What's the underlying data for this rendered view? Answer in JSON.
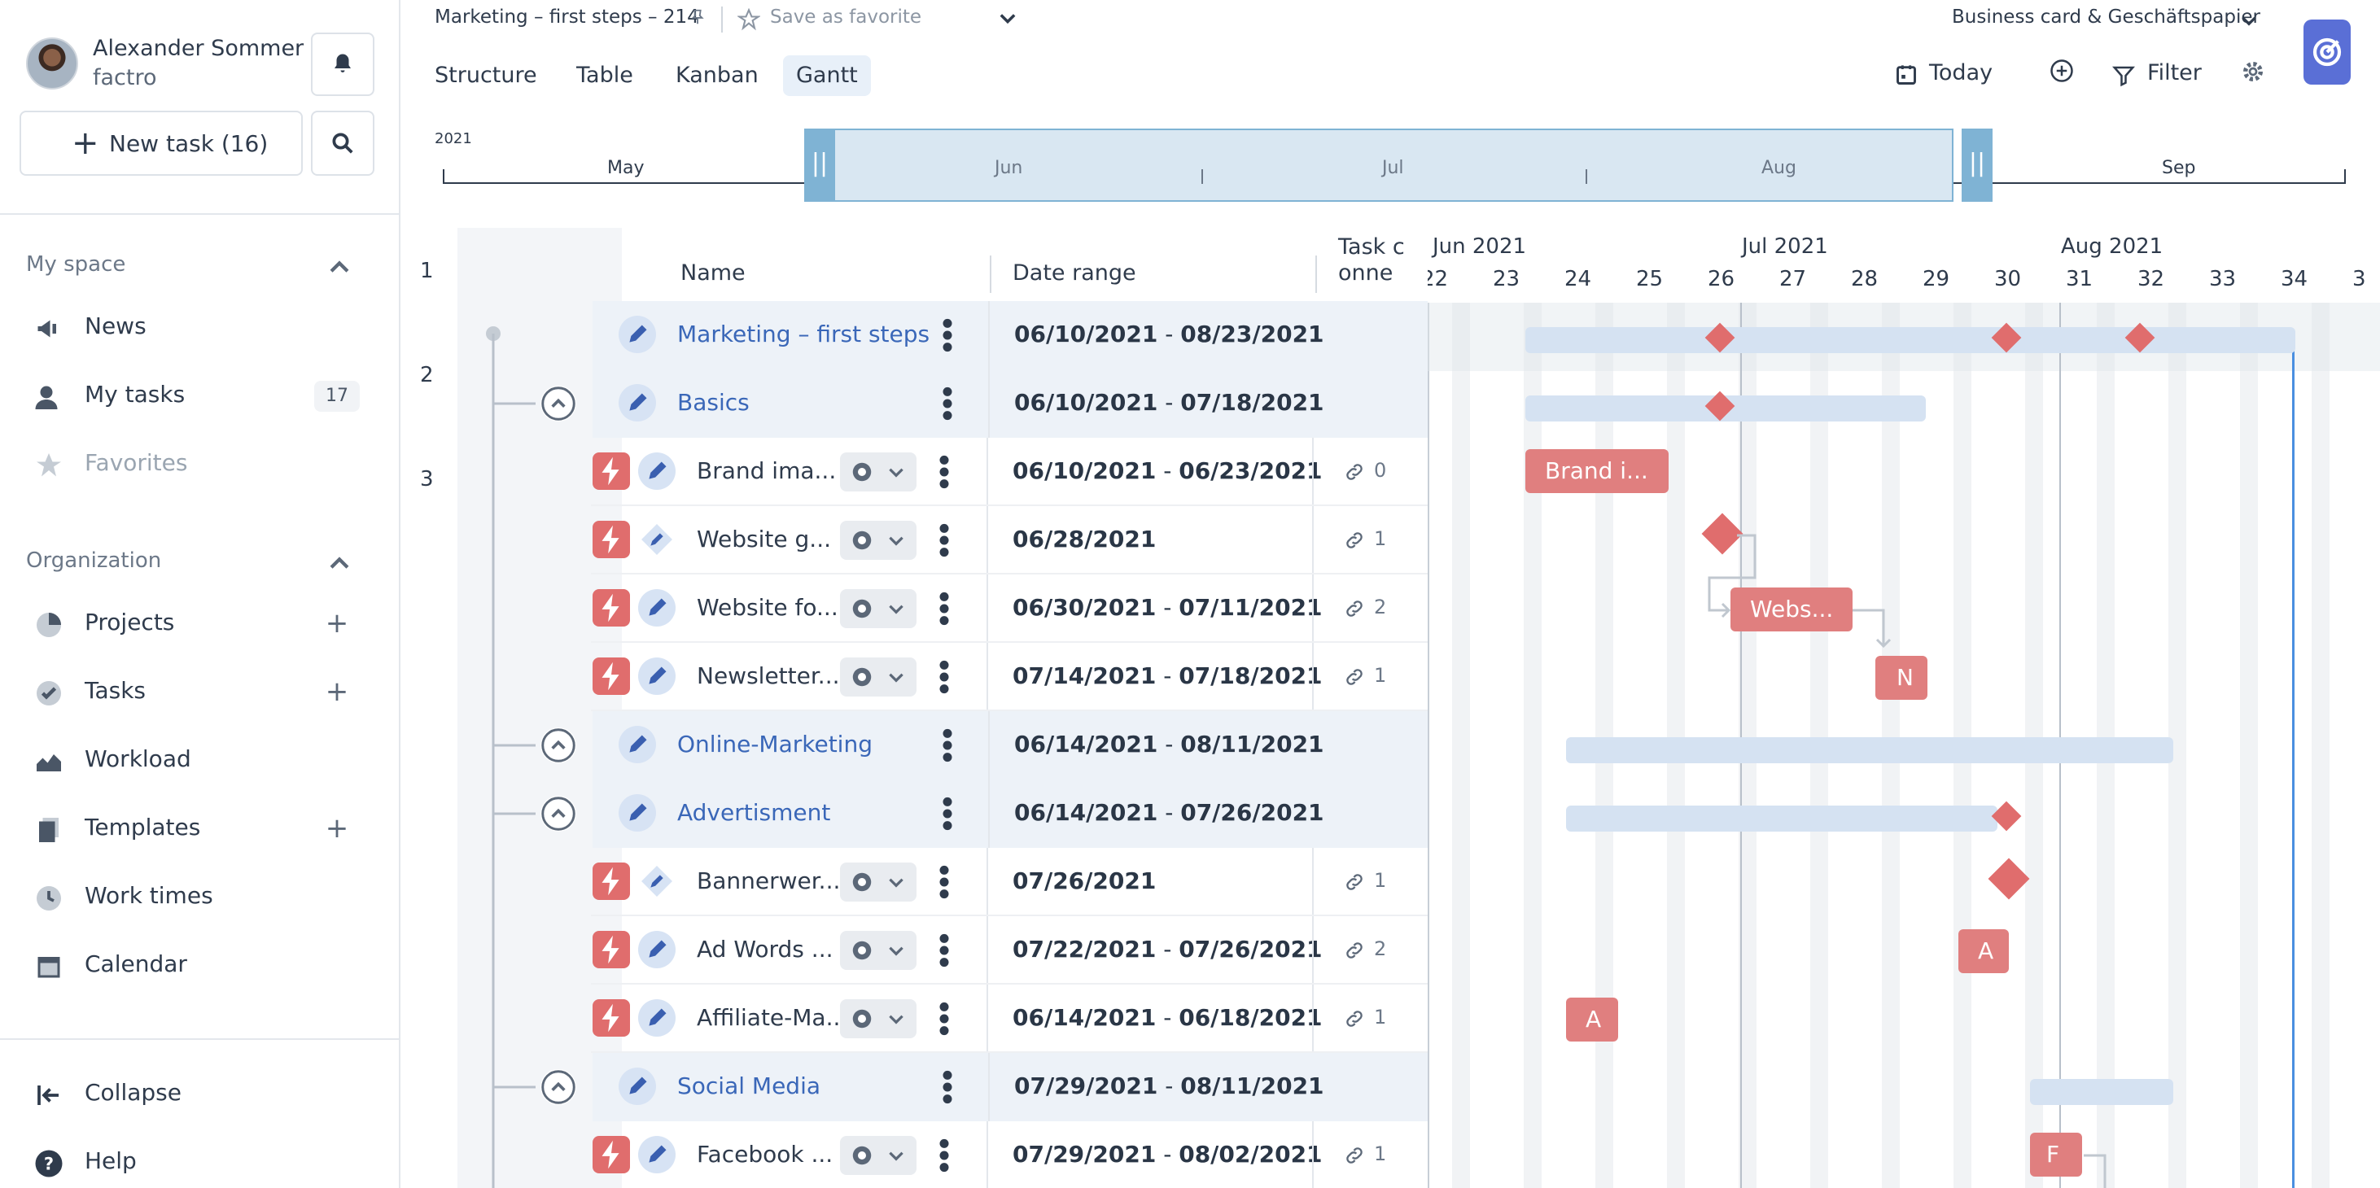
{
  "user": {
    "name": "Alexander Sommer",
    "company": "factro"
  },
  "sidebar": {
    "new_task": "New task (16)",
    "my_space_title": "My space",
    "my_space": [
      {
        "label": "News",
        "icon": "megaphone-icon"
      },
      {
        "label": "My tasks",
        "icon": "user-icon",
        "badge": "17"
      },
      {
        "label": "Favorites",
        "icon": "star-icon"
      }
    ],
    "org_title": "Organization",
    "org": [
      {
        "label": "Projects",
        "icon": "pie-chart-icon"
      },
      {
        "label": "Tasks",
        "icon": "check-circle-icon"
      },
      {
        "label": "Workload",
        "icon": "area-chart-icon"
      },
      {
        "label": "Templates",
        "icon": "templates-icon"
      },
      {
        "label": "Work times",
        "icon": "clock-icon"
      },
      {
        "label": "Calendar",
        "icon": "calendar-icon"
      }
    ],
    "collapse": "Collapse",
    "help": "Help"
  },
  "header": {
    "project": "Marketing – first steps – 214",
    "favorite": "Save as favorite",
    "workspace": "Business card & Geschäftspapier",
    "tabs": [
      "Structure",
      "Table",
      "Kanban",
      "Gantt"
    ],
    "active_tab": "Gantt",
    "today": "Today",
    "filter": "Filter"
  },
  "timeline": {
    "year": "2021",
    "months": [
      "May",
      "Jun",
      "Jul",
      "Aug",
      "Sep"
    ]
  },
  "grid": {
    "row_numbers": [
      "1",
      "2",
      "3"
    ],
    "col_name": "Name",
    "col_date": "Date range",
    "col_conn": "Task conne",
    "rows": [
      {
        "type": "project",
        "name": "Marketing – first steps",
        "start": "06/10/2021",
        "end": "08/23/2021"
      },
      {
        "type": "group",
        "name": "Basics",
        "start": "06/10/2021",
        "end": "07/18/2021"
      },
      {
        "type": "task",
        "name": "Brand ima...",
        "start": "06/10/2021",
        "end": "06/23/2021",
        "links": "0"
      },
      {
        "type": "milestone",
        "name": "Website g...",
        "start": "06/28/2021",
        "end": "",
        "links": "1"
      },
      {
        "type": "task",
        "name": "Website fo...",
        "start": "06/30/2021",
        "end": "07/11/2021",
        "links": "2"
      },
      {
        "type": "task",
        "name": "Newsletter...",
        "start": "07/14/2021",
        "end": "07/18/2021",
        "links": "1"
      },
      {
        "type": "group",
        "name": "Online-Marketing",
        "start": "06/14/2021",
        "end": "08/11/2021"
      },
      {
        "type": "group",
        "name": "Advertisment",
        "start": "06/14/2021",
        "end": "07/26/2021"
      },
      {
        "type": "milestone",
        "name": "Bannerwer...",
        "start": "07/26/2021",
        "end": "",
        "links": "1"
      },
      {
        "type": "task",
        "name": "Ad Words ...",
        "start": "07/22/2021",
        "end": "07/26/2021",
        "links": "2"
      },
      {
        "type": "task",
        "name": "Affiliate-Ma...",
        "start": "06/14/2021",
        "end": "06/18/2021",
        "links": "1"
      },
      {
        "type": "group",
        "name": "Social Media",
        "start": "07/29/2021",
        "end": "08/11/2021"
      },
      {
        "type": "task",
        "name": "Facebook ...",
        "start": "07/29/2021",
        "end": "08/02/2021",
        "links": "1"
      }
    ]
  },
  "gantt": {
    "months": [
      "Jun 2021",
      "Jul 2021",
      "Aug 2021"
    ],
    "weeks": [
      "22",
      "23",
      "24",
      "25",
      "26",
      "27",
      "28",
      "29",
      "30",
      "31",
      "32",
      "33",
      "34",
      "3"
    ],
    "bar_labels": {
      "brand": "Brand i...",
      "website": "Webs...",
      "newsletter": "N",
      "adwords": "A",
      "affiliate": "A",
      "facebook": "F"
    }
  },
  "colors": {
    "accent": "#5a6fd6",
    "task": "#e07f7f",
    "group_bar": "#d5e2f2",
    "group_row": "#edf2f8"
  }
}
